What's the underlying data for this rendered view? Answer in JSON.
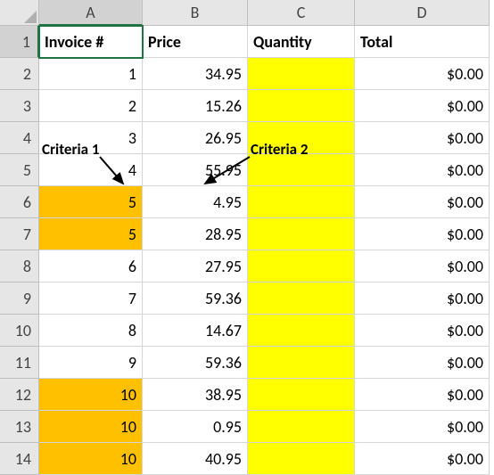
{
  "columns": [
    "A",
    "B",
    "C",
    "D"
  ],
  "row_numbers": [
    1,
    2,
    3,
    4,
    5,
    6,
    7,
    8,
    9,
    10,
    11,
    12,
    13,
    14
  ],
  "selected_cell": "A1",
  "headers": {
    "A": "Invoice #",
    "B": "Price",
    "C": "Quantity",
    "D": "Total"
  },
  "rows": [
    {
      "invoice": "1",
      "price": "34.95",
      "qty": "",
      "total": "$0.00",
      "a_fill": "",
      "c_fill": "yellow"
    },
    {
      "invoice": "2",
      "price": "15.26",
      "qty": "",
      "total": "$0.00",
      "a_fill": "",
      "c_fill": "yellow"
    },
    {
      "invoice": "3",
      "price": "26.95",
      "qty": "",
      "total": "$0.00",
      "a_fill": "",
      "c_fill": "yellow"
    },
    {
      "invoice": "4",
      "price": "55.95",
      "qty": "",
      "total": "$0.00",
      "a_fill": "",
      "c_fill": "yellow"
    },
    {
      "invoice": "5",
      "price": "4.95",
      "qty": "",
      "total": "$0.00",
      "a_fill": "orange",
      "c_fill": "yellow"
    },
    {
      "invoice": "5",
      "price": "28.95",
      "qty": "",
      "total": "$0.00",
      "a_fill": "orange",
      "c_fill": "yellow"
    },
    {
      "invoice": "6",
      "price": "27.95",
      "qty": "",
      "total": "$0.00",
      "a_fill": "",
      "c_fill": "yellow"
    },
    {
      "invoice": "7",
      "price": "59.36",
      "qty": "",
      "total": "$0.00",
      "a_fill": "",
      "c_fill": "yellow"
    },
    {
      "invoice": "8",
      "price": "14.67",
      "qty": "",
      "total": "$0.00",
      "a_fill": "",
      "c_fill": "yellow"
    },
    {
      "invoice": "9",
      "price": "59.36",
      "qty": "",
      "total": "$0.00",
      "a_fill": "",
      "c_fill": "yellow"
    },
    {
      "invoice": "10",
      "price": "38.95",
      "qty": "",
      "total": "$0.00",
      "a_fill": "orange",
      "c_fill": "yellow"
    },
    {
      "invoice": "10",
      "price": "0.95",
      "qty": "",
      "total": "$0.00",
      "a_fill": "orange",
      "c_fill": "yellow"
    },
    {
      "invoice": "10",
      "price": "40.95",
      "qty": "",
      "total": "$0.00",
      "a_fill": "orange",
      "c_fill": "yellow"
    }
  ],
  "annotations": {
    "criteria1": "Criteria 1",
    "criteria2": "Criteria 2"
  },
  "chart_data": {
    "type": "table",
    "title": "",
    "columns": [
      "Invoice #",
      "Price",
      "Quantity",
      "Total"
    ],
    "data": [
      [
        1,
        34.95,
        null,
        0.0
      ],
      [
        2,
        15.26,
        null,
        0.0
      ],
      [
        3,
        26.95,
        null,
        0.0
      ],
      [
        4,
        55.95,
        null,
        0.0
      ],
      [
        5,
        4.95,
        null,
        0.0
      ],
      [
        5,
        28.95,
        null,
        0.0
      ],
      [
        6,
        27.95,
        null,
        0.0
      ],
      [
        7,
        59.36,
        null,
        0.0
      ],
      [
        8,
        14.67,
        null,
        0.0
      ],
      [
        9,
        59.36,
        null,
        0.0
      ],
      [
        10,
        38.95,
        null,
        0.0
      ],
      [
        10,
        0.95,
        null,
        0.0
      ],
      [
        10,
        40.95,
        null,
        0.0
      ]
    ],
    "highlights": {
      "Criteria 1": {
        "column": "Invoice #",
        "fill": "#ffc000",
        "rows_highlighted": [
          5,
          6,
          11,
          12,
          13
        ]
      },
      "Criteria 2": {
        "column": "Quantity",
        "fill": "#ffff00",
        "rows_highlighted": "all"
      }
    }
  }
}
